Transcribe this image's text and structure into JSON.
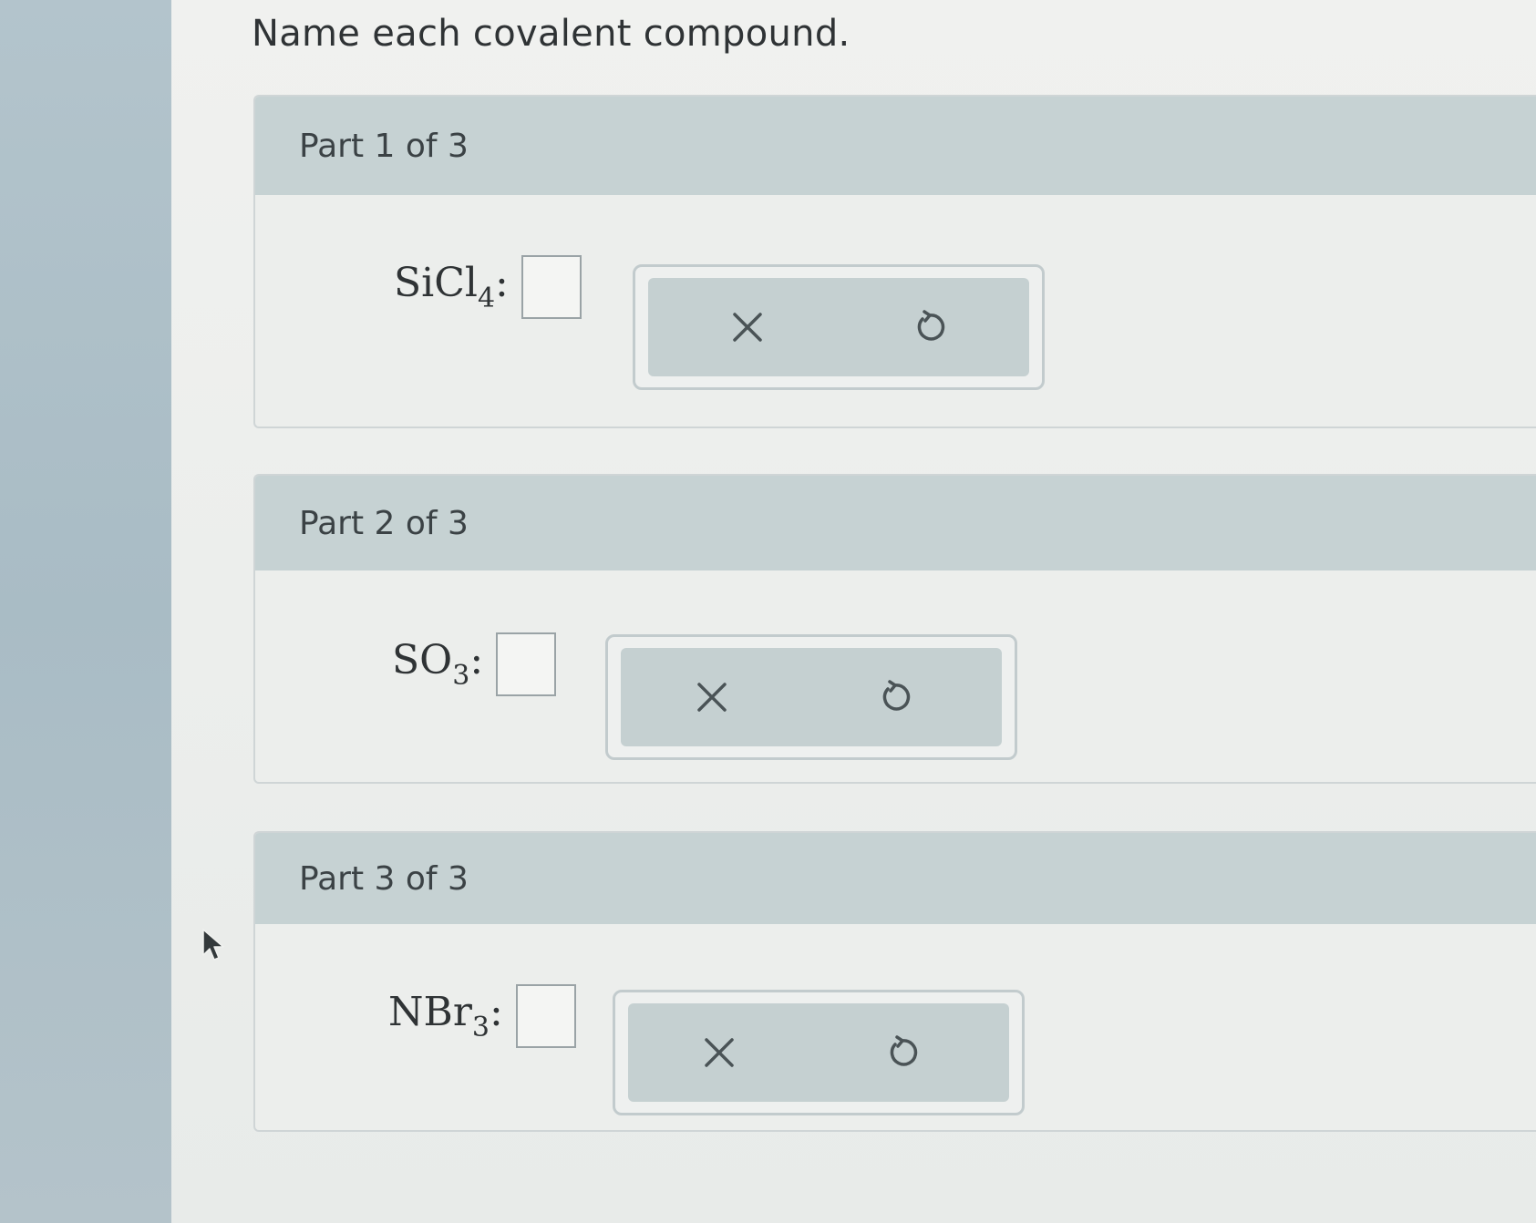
{
  "question": "Name each covalent compound.",
  "parts": [
    {
      "title": "Part 1 of 3",
      "formula": {
        "base": "SiCl",
        "subscript": "4",
        "colon": ":"
      },
      "answer_value": "",
      "clear_icon": "x-icon",
      "undo_icon": "undo-icon"
    },
    {
      "title": "Part 2 of 3",
      "formula": {
        "base": "SO",
        "subscript": "3",
        "colon": ":"
      },
      "answer_value": "",
      "clear_icon": "x-icon",
      "undo_icon": "undo-icon"
    },
    {
      "title": "Part 3 of 3",
      "formula": {
        "base": "NBr",
        "subscript": "3",
        "colon": ":"
      },
      "answer_value": "",
      "clear_icon": "x-icon",
      "undo_icon": "undo-icon"
    }
  ],
  "colors": {
    "header_bg": "#c6d2d3",
    "panel_bg": "#c5d0d1",
    "icon": "#4a5356",
    "text": "#2f3335"
  }
}
